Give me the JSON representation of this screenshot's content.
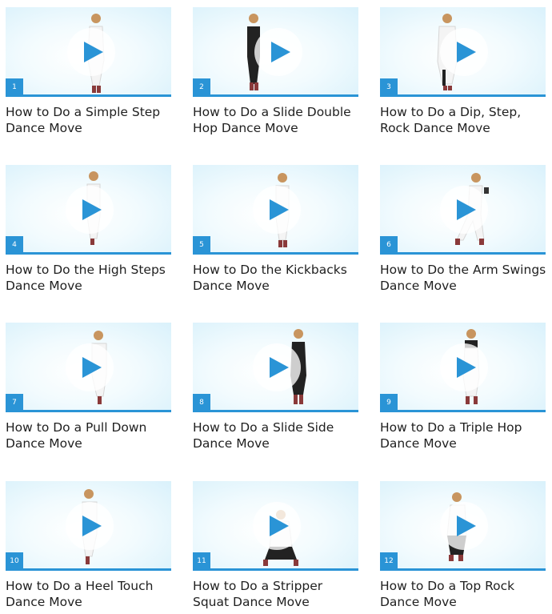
{
  "colors": {
    "accent": "#2a94d6",
    "title_text": "#1f1f1f",
    "thumb_background": "#dff3fb"
  },
  "icons": {
    "play": "play-icon",
    "figure": "dancer-figure"
  },
  "videos": [
    {
      "number": "1",
      "title": "How to Do a Simple Step\nDance Move"
    },
    {
      "number": "2",
      "title": "How to Do a Slide Double\nHop Dance Move"
    },
    {
      "number": "3",
      "title": "How to Do a Dip, Step,\nRock Dance Move"
    },
    {
      "number": "4",
      "title": "How to Do the High Steps\nDance Move"
    },
    {
      "number": "5",
      "title": "How to Do the Kickbacks\nDance Move"
    },
    {
      "number": "6",
      "title": "How to Do the Arm Swings\nDance Move"
    },
    {
      "number": "7",
      "title": "How to Do a Pull Down\nDance Move"
    },
    {
      "number": "8",
      "title": "How to Do a Slide Side\nDance Move"
    },
    {
      "number": "9",
      "title": "How to Do a Triple Hop\nDance Move"
    },
    {
      "number": "10",
      "title": "How to Do a Heel Touch\nDance Move"
    },
    {
      "number": "11",
      "title": "How to Do a Stripper\nSquat Dance Move"
    },
    {
      "number": "12",
      "title": "How to Do a Top Rock\nDance Move"
    }
  ]
}
